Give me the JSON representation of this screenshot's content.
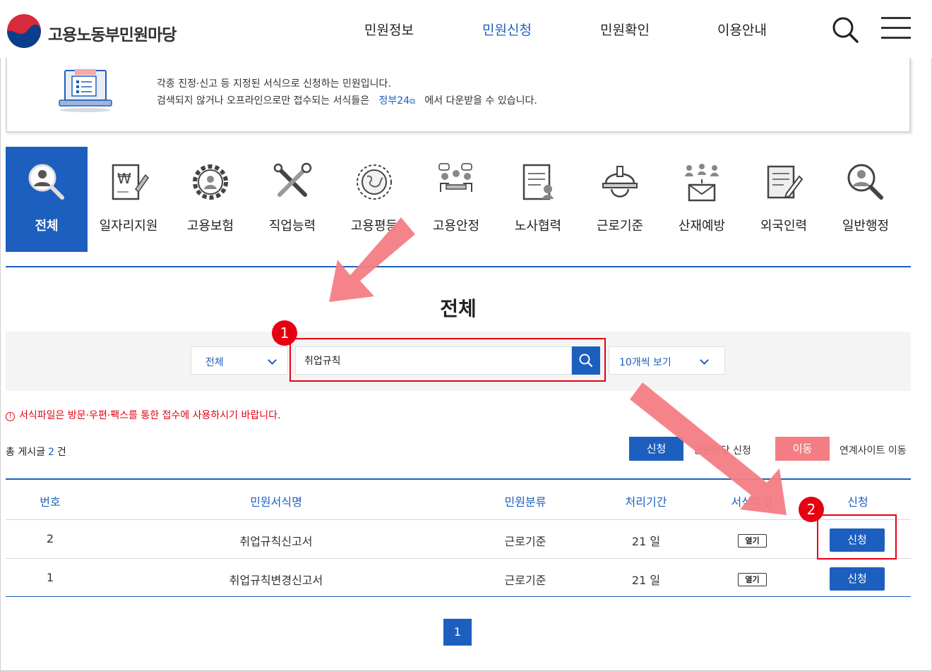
{
  "header": {
    "logo_text": "고용노동부민원마당",
    "nav": [
      "민원정보",
      "민원신청",
      "민원확인",
      "이용안내"
    ],
    "active_nav": "민원신청"
  },
  "notice": {
    "line1": "각종 진정·신고 등 지정된 서식으로 신청하는 민원입니다.",
    "line2_before": "검색되지 않거나 오프라인으로만 접수되는 서식들은",
    "line2_link": "정부24",
    "line2_after": "에서 다운받을 수 있습니다."
  },
  "categories": [
    {
      "label": "전체",
      "icon": "person-search-icon",
      "active": true
    },
    {
      "label": "일자리지원",
      "icon": "document-won-icon"
    },
    {
      "label": "고용보험",
      "icon": "gear-person-icon"
    },
    {
      "label": "직업능력",
      "icon": "tools-icon"
    },
    {
      "label": "고용평등",
      "icon": "globe-icon"
    },
    {
      "label": "고용안정",
      "icon": "meeting-icon"
    },
    {
      "label": "노사협력",
      "icon": "contract-icon"
    },
    {
      "label": "근로기준",
      "icon": "helmet-icon"
    },
    {
      "label": "산재예방",
      "icon": "mail-people-icon"
    },
    {
      "label": "외국인력",
      "icon": "form-pen-icon"
    },
    {
      "label": "일반행정",
      "icon": "person-search-icon"
    }
  ],
  "section_title": "전체",
  "search": {
    "category_value": "전체",
    "query_value": "취업규칙",
    "per_page_value": "10개씩 보기"
  },
  "warning": "서식파일은 방문·우편·팩스를 통한 접수에 사용하시기 바랍니다.",
  "total": {
    "prefix": "총 게시글",
    "count": "2",
    "suffix": "건"
  },
  "legend": {
    "apply_button": "신청",
    "apply_text": "민원마당 신청",
    "move_button": "이동",
    "move_text": "연계사이트 이동"
  },
  "table": {
    "headers": [
      "번호",
      "민원서식명",
      "민원분류",
      "처리기간",
      "서식파일",
      "신청"
    ],
    "rows": [
      {
        "no": "2",
        "name": "취업규칙신고서",
        "category": "근로기준",
        "period": "21 일",
        "file": "열기",
        "action": "신청"
      },
      {
        "no": "1",
        "name": "취업규칙변경신고서",
        "category": "근로기준",
        "period": "21 일",
        "file": "열기",
        "action": "신청"
      }
    ]
  },
  "pagination": {
    "current": "1"
  },
  "annotations": {
    "badge1": "1",
    "badge2": "2"
  },
  "colors": {
    "primary": "#1d5fbf",
    "annotation": "#e60012",
    "move": "#f47d84"
  }
}
